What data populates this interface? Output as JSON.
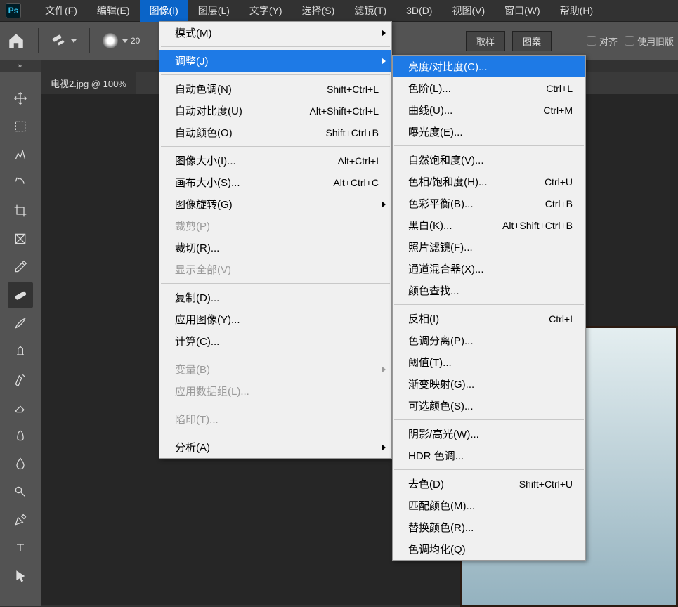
{
  "app": {
    "logo_text": "Ps"
  },
  "menubar": {
    "items": [
      "文件(F)",
      "编辑(E)",
      "图像(I)",
      "图层(L)",
      "文字(Y)",
      "选择(S)",
      "滤镜(T)",
      "3D(D)",
      "视图(V)",
      "窗口(W)",
      "帮助(H)"
    ],
    "active_index": 2
  },
  "option_bar": {
    "brush_size": "20",
    "tab_sample": "取样",
    "tab_pattern": "图案",
    "align_label": "对齐",
    "legacy_label": "使用旧版"
  },
  "doc_tab": {
    "title": "电视2.jpg @ 100%"
  },
  "dropdown1": {
    "mode": {
      "label": "模式(M)",
      "arrow": true
    },
    "adjust": {
      "label": "调整(J)",
      "arrow": true
    },
    "auto_tone": {
      "label": "自动色调(N)",
      "shortcut": "Shift+Ctrl+L"
    },
    "auto_contrast": {
      "label": "自动对比度(U)",
      "shortcut": "Alt+Shift+Ctrl+L"
    },
    "auto_color": {
      "label": "自动颜色(O)",
      "shortcut": "Shift+Ctrl+B"
    },
    "image_size": {
      "label": "图像大小(I)...",
      "shortcut": "Alt+Ctrl+I"
    },
    "canvas_size": {
      "label": "画布大小(S)...",
      "shortcut": "Alt+Ctrl+C"
    },
    "image_rotation": {
      "label": "图像旋转(G)",
      "arrow": true
    },
    "crop": {
      "label": "裁剪(P)"
    },
    "trim": {
      "label": "裁切(R)..."
    },
    "reveal_all": {
      "label": "显示全部(V)"
    },
    "duplicate": {
      "label": "复制(D)..."
    },
    "apply_image": {
      "label": "应用图像(Y)..."
    },
    "calculations": {
      "label": "计算(C)..."
    },
    "variables": {
      "label": "变量(B)",
      "arrow": true
    },
    "apply_data": {
      "label": "应用数据组(L)..."
    },
    "trap": {
      "label": "陷印(T)..."
    },
    "analysis": {
      "label": "分析(A)",
      "arrow": true
    }
  },
  "dropdown2": {
    "brightness": {
      "label": "亮度/对比度(C)..."
    },
    "levels": {
      "label": "色阶(L)...",
      "shortcut": "Ctrl+L"
    },
    "curves": {
      "label": "曲线(U)...",
      "shortcut": "Ctrl+M"
    },
    "exposure": {
      "label": "曝光度(E)..."
    },
    "vibrance": {
      "label": "自然饱和度(V)..."
    },
    "hue_sat": {
      "label": "色相/饱和度(H)...",
      "shortcut": "Ctrl+U"
    },
    "color_balance": {
      "label": "色彩平衡(B)...",
      "shortcut": "Ctrl+B"
    },
    "black_white": {
      "label": "黑白(K)...",
      "shortcut": "Alt+Shift+Ctrl+B"
    },
    "photo_filter": {
      "label": "照片滤镜(F)..."
    },
    "channel_mixer": {
      "label": "通道混合器(X)..."
    },
    "color_lookup": {
      "label": "颜色查找..."
    },
    "invert": {
      "label": "反相(I)",
      "shortcut": "Ctrl+I"
    },
    "posterize": {
      "label": "色调分离(P)..."
    },
    "threshold": {
      "label": "阈值(T)..."
    },
    "gradient_map": {
      "label": "渐变映射(G)..."
    },
    "selective_color": {
      "label": "可选颜色(S)..."
    },
    "shadow_highlight": {
      "label": "阴影/高光(W)..."
    },
    "hdr_toning": {
      "label": "HDR 色调..."
    },
    "desaturate": {
      "label": "去色(D)",
      "shortcut": "Shift+Ctrl+U"
    },
    "match_color": {
      "label": "匹配颜色(M)..."
    },
    "replace_color": {
      "label": "替换颜色(R)..."
    },
    "equalize": {
      "label": "色调均化(Q)"
    }
  }
}
